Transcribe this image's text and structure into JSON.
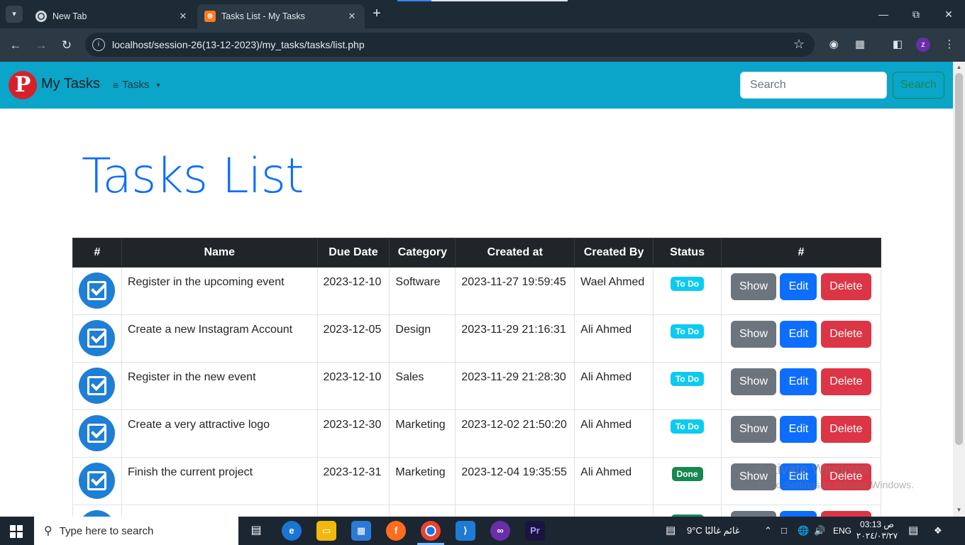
{
  "browser": {
    "tabs": [
      {
        "title": "New Tab",
        "active": false
      },
      {
        "title": "Tasks List - My Tasks",
        "active": true
      }
    ],
    "url": "localhost/session-26(13-12-2023)/my_tasks/tasks/list.php",
    "profile_initial": "z"
  },
  "navbar": {
    "brand_letter": "P",
    "brand": "My Tasks",
    "menu_label": "Tasks",
    "search_placeholder": "Search",
    "search_button": "Search",
    "colors": {
      "navbar_bg": "#0aa5c8",
      "brand_logo": "#d8202b"
    }
  },
  "page": {
    "title": "Tasks List"
  },
  "table": {
    "headers": [
      "#",
      "Name",
      "Due Date",
      "Category",
      "Created at",
      "Created By",
      "Status",
      "#"
    ],
    "rows": [
      {
        "name": "Register in the upcoming event",
        "due": "2023-12-10",
        "category": "Software",
        "created_at": "2023-11-27 19:59:45",
        "created_by": "Wael Ahmed",
        "status": "To Do"
      },
      {
        "name": "Create a new Instagram Account",
        "due": "2023-12-05",
        "category": "Design",
        "created_at": "2023-11-29 21:16:31",
        "created_by": "Ali Ahmed",
        "status": "To Do"
      },
      {
        "name": "Register in the new event",
        "due": "2023-12-10",
        "category": "Sales",
        "created_at": "2023-11-29 21:28:30",
        "created_by": "Ali Ahmed",
        "status": "To Do"
      },
      {
        "name": "Create a very attractive logo",
        "due": "2023-12-30",
        "category": "Marketing",
        "created_at": "2023-12-02 21:50:20",
        "created_by": "Ali Ahmed",
        "status": "To Do"
      },
      {
        "name": "Finish the current project",
        "due": "2023-12-31",
        "category": "Marketing",
        "created_at": "2023-12-04 19:35:55",
        "created_by": "Ali Ahmed",
        "status": "Done"
      }
    ],
    "actions": {
      "show": "Show",
      "edit": "Edit",
      "delete": "Delete"
    },
    "status_colors": {
      "To Do": "#0dcaf0",
      "Done": "#198754"
    }
  },
  "watermark": {
    "line1": "Activate Windows",
    "line2": "Go to Settings to activate Windows."
  },
  "taskbar": {
    "search_placeholder": "Type here to search",
    "weather": "9°C  غائم غالبًا",
    "language": "ENG",
    "time": "03:13 ص",
    "date": "٢٠٢٤/٠٣/٢٧"
  }
}
